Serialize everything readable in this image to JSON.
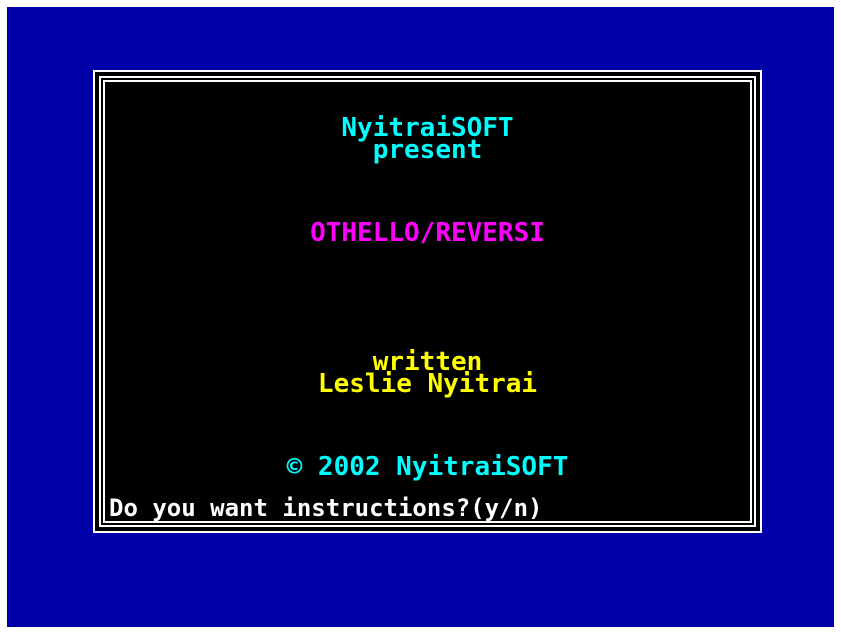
{
  "company": "NyitraiSOFT",
  "present": "present",
  "game_title": "OTHELLO/REVERSI",
  "written": "written",
  "author": "Leslie Nyitrai",
  "copyright": "© 2002 NyitraiSOFT",
  "prompt": "Do you want instructions?(y/n)",
  "colors": {
    "border": "#0000aa",
    "paper": "#000000",
    "cyan": "#00ffff",
    "magenta": "#ff00ff",
    "yellow": "#ffff00",
    "white": "#ffffff"
  }
}
